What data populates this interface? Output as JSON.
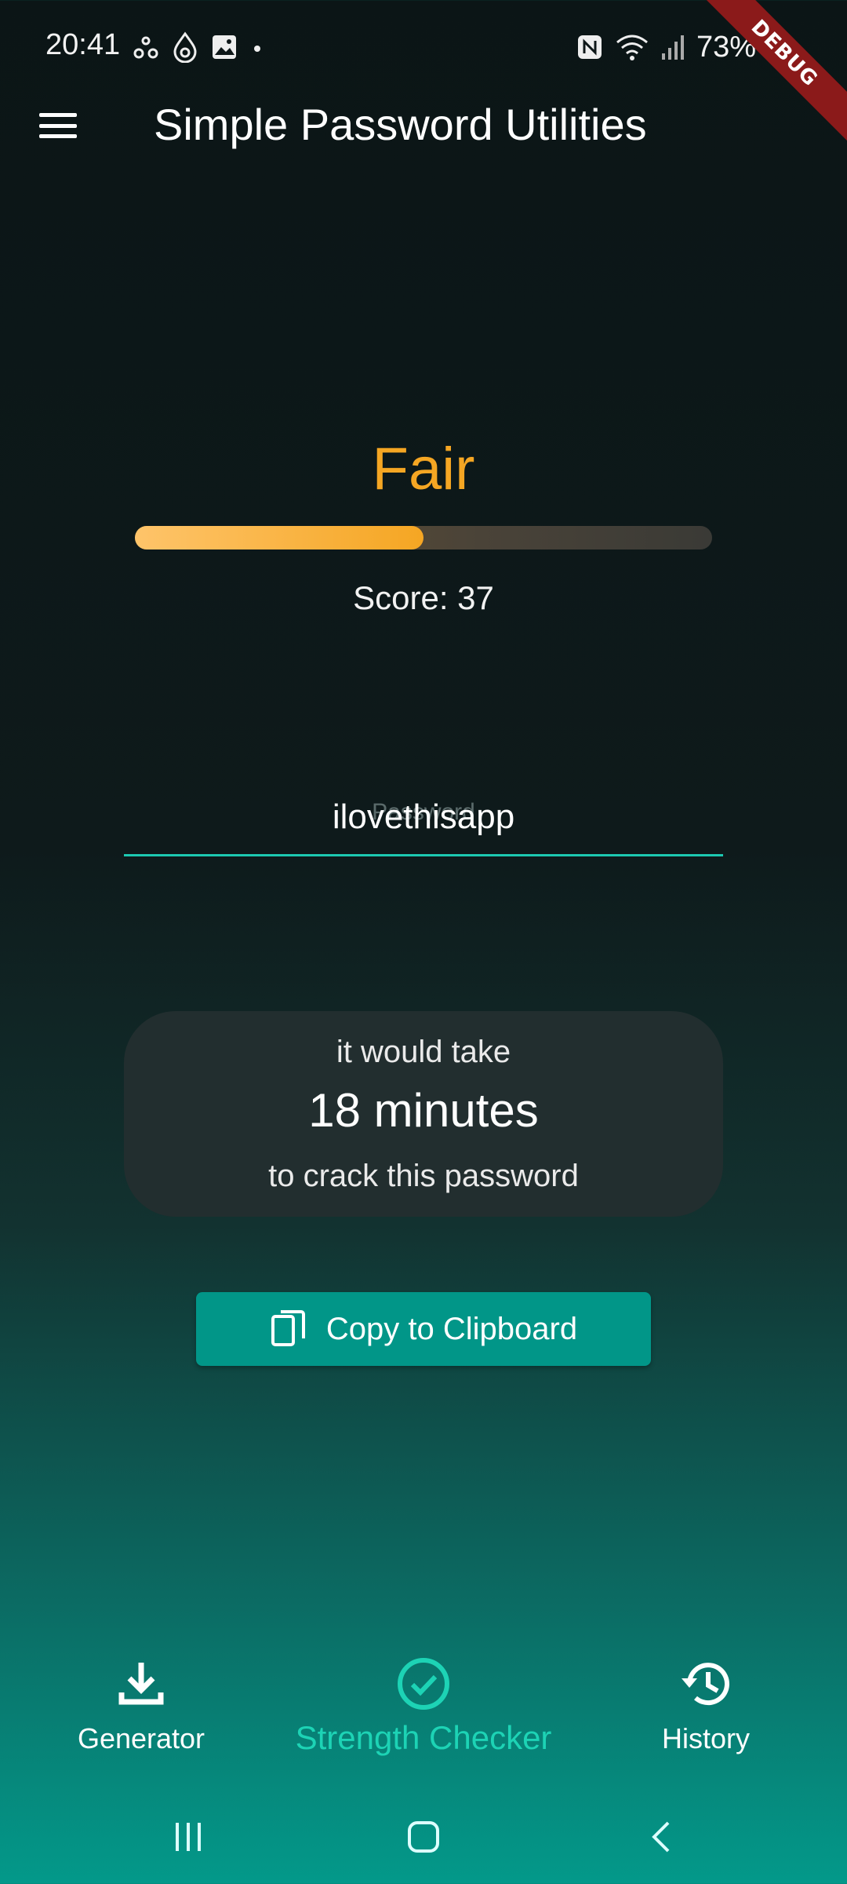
{
  "status_bar": {
    "time": "20:41",
    "battery": "73%",
    "left_icons": [
      "drops-icon",
      "water-drop-icon",
      "image-icon",
      "dot-icon"
    ],
    "right_icons": [
      "nfc-icon",
      "wifi-icon",
      "signal-icon",
      "battery-icon"
    ]
  },
  "debug_banner": "DEBUG",
  "app_bar": {
    "title": "Simple Password Utilities",
    "menu_icon": "menu-icon"
  },
  "strength": {
    "label": "Fair",
    "score_label": "Score:",
    "score_value": "37",
    "progress_fraction": 0.5,
    "color": "#f5a623"
  },
  "password_field": {
    "placeholder": "Password",
    "value": "ilovethisapp"
  },
  "crack_card": {
    "line1": "it would take",
    "time": "18 minutes",
    "line3": "to crack this password"
  },
  "copy_button": {
    "label": "Copy to Clipboard",
    "icon": "copy-icon"
  },
  "bottom_nav": {
    "items": [
      {
        "label": "Generator",
        "icon": "download-icon",
        "active": false
      },
      {
        "label": "Strength Checker",
        "icon": "check-circle-icon",
        "active": true
      },
      {
        "label": "History",
        "icon": "history-icon",
        "active": false
      }
    ],
    "accent": "#1dd3b5"
  },
  "colors": {
    "teal": "#019688",
    "accent": "#1cc9b2",
    "card": "#222e2f"
  }
}
